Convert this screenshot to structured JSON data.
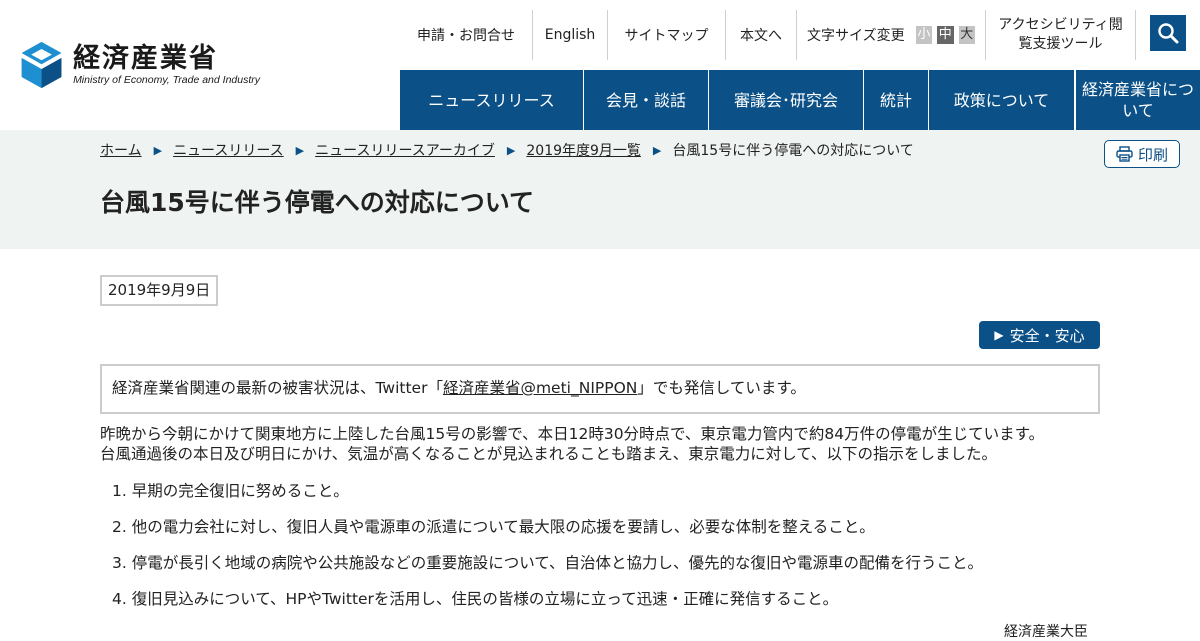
{
  "logo": {
    "name_ja": "経済産業省",
    "name_en": "Ministry of Economy, Trade and Industry"
  },
  "util_nav": {
    "items": [
      "申請・お問合せ",
      "English",
      "サイトマップ",
      "本文へ"
    ],
    "font_size_label": "文字サイズ変更",
    "font_sizes": [
      "小",
      "中",
      "大"
    ],
    "accessibility": "アクセシビリティ閲覧支援ツール"
  },
  "main_nav": {
    "items": [
      "ニュースリリース",
      "会見・談話",
      "審議会･研究会",
      "統計",
      "政策について",
      "経済産業省について"
    ]
  },
  "breadcrumb": {
    "items": [
      "ホーム",
      "ニュースリリース",
      "ニュースリリースアーカイブ",
      "2019年度9月一覧"
    ],
    "current": "台風15号に伴う停電への対応について"
  },
  "print_label": "印刷",
  "page_title": "台風15号に伴う停電への対応について",
  "date": "2019年9月9日",
  "tag": "安全・安心",
  "notice": {
    "before": "経済産業省関連の最新の被害状況は、Twitter「",
    "link": "経済産業省@meti_NIPPON",
    "after": "」でも発信しています。"
  },
  "body": {
    "line1": "昨晩から今朝にかけて関東地方に上陸した台風15号の影響で、本日12時30分時点で、東京電力管内で約84万件の停電が生じています。",
    "line2": "台風通過後の本日及び明日にかけ、気温が高くなることが見込まれることも踏まえ、東京電力に対して、以下の指示をしました。"
  },
  "instructions": [
    "1. 早期の完全復旧に努めること。",
    "2. 他の電力会社に対し、復旧人員や電源車の派遣について最大限の応援を要請し、必要な体制を整えること。",
    "3. 停電が長引く地域の病院や公共施設などの重要施設について、自治体と協力し、優先的な復旧や電源車の配備を行うこと。",
    "4. 復旧見込みについて、HPやTwitterを活用し、住民の皆様の立場に立って迅速・正確に発信すること。"
  ],
  "signature": "経済産業大臣",
  "colors": {
    "brand_blue": "#0b5087",
    "logo_blue": "#1e8fd0",
    "band_bg": "#eff3f2"
  }
}
